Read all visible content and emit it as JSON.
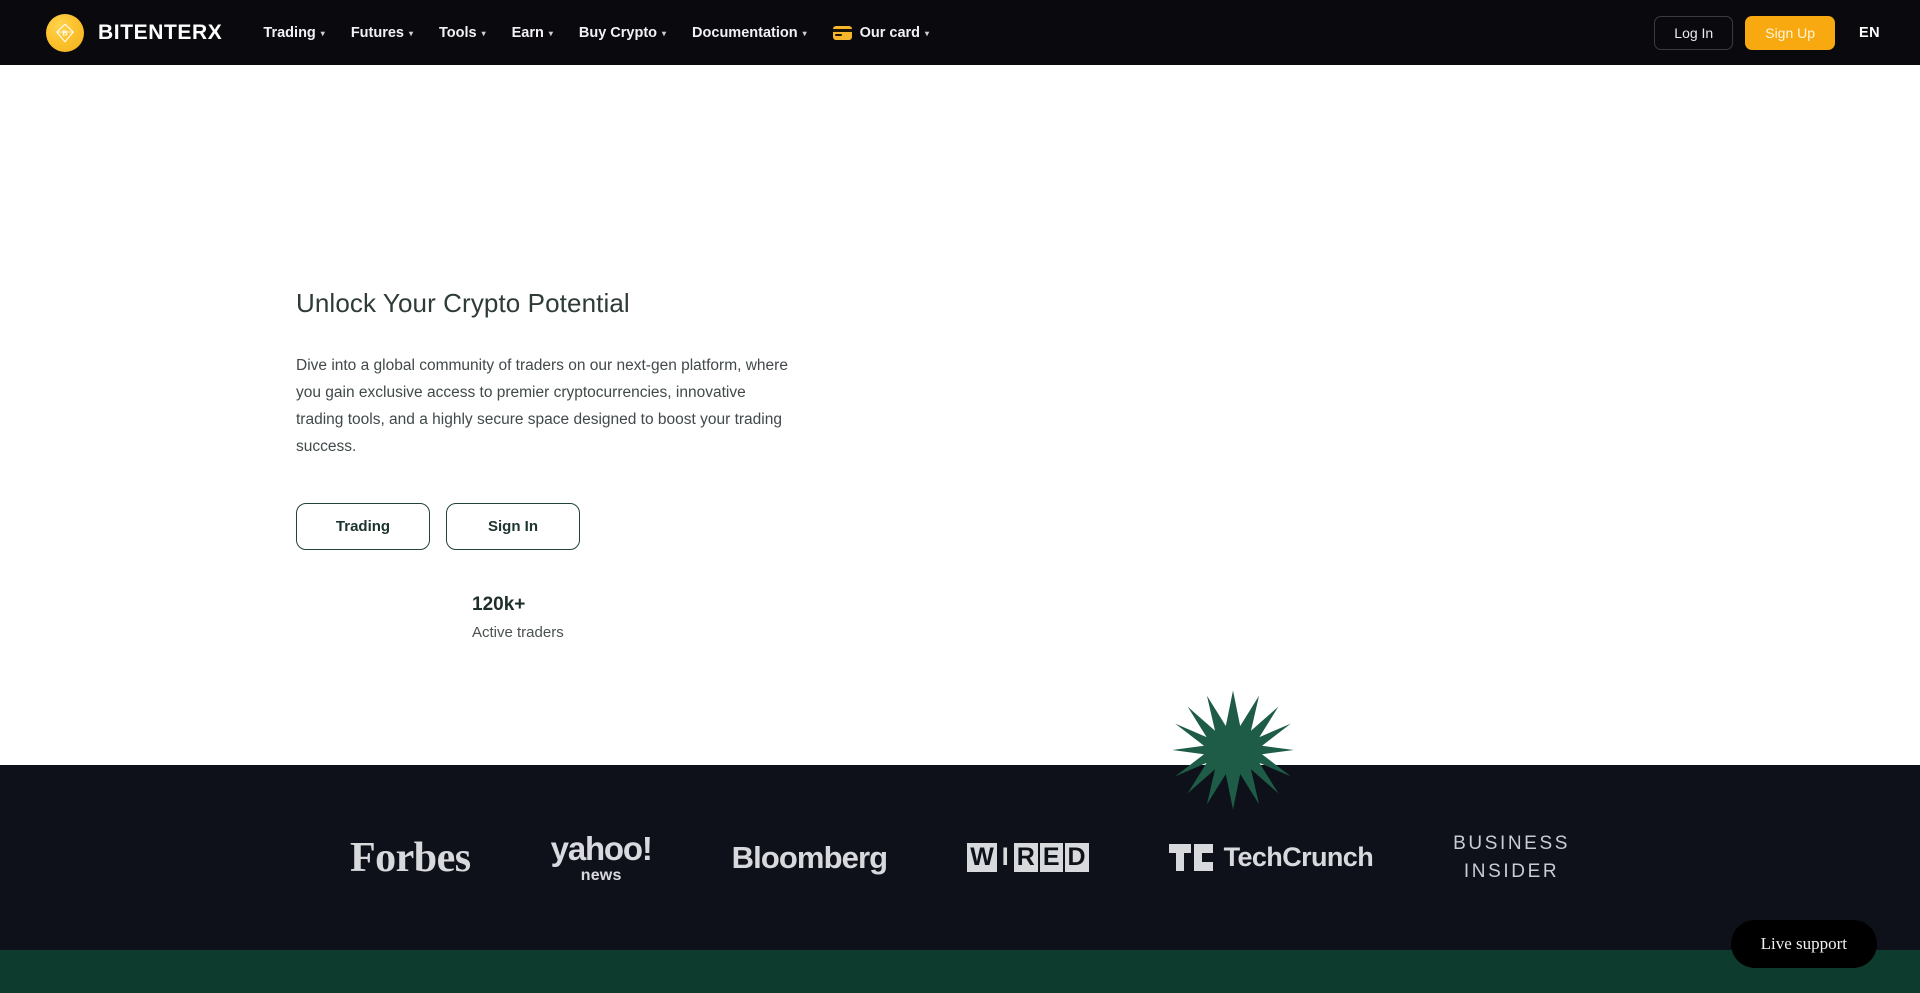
{
  "header": {
    "brand": {
      "name": "BITENTERX",
      "mark_icon": "bitcoin-diamond-icon",
      "mark_color": "#fcc22e"
    },
    "nav": [
      {
        "label": "Trading",
        "has_dropdown": true,
        "icon": null
      },
      {
        "label": "Futures",
        "has_dropdown": true,
        "icon": null
      },
      {
        "label": "Tools",
        "has_dropdown": true,
        "icon": null
      },
      {
        "label": "Earn",
        "has_dropdown": true,
        "icon": null
      },
      {
        "label": "Buy Crypto",
        "has_dropdown": true,
        "icon": null
      },
      {
        "label": "Documentation",
        "has_dropdown": true,
        "icon": null
      },
      {
        "label": "Our card",
        "has_dropdown": true,
        "icon": "credit-card-icon"
      }
    ],
    "login_label": "Log In",
    "signup_label": "Sign Up",
    "language": "EN",
    "signup_color": "#f7a90f",
    "background": "#0a0a0e"
  },
  "hero": {
    "title": "Unlock Your Crypto Potential",
    "subtitle": "Dive into a global community of traders on our next-gen platform, where you gain exclusive access to premier cryptocurrencies, innovative trading tools, and a highly secure space designed to boost your trading success.",
    "primary_button": "Trading",
    "secondary_button": "Sign In",
    "stat_value": "120k+",
    "stat_label": "Active traders",
    "accent_color": "#1f5c47",
    "background": "#ffffff"
  },
  "starburst": {
    "icon": "star-burst-icon",
    "points": 12,
    "color": "#1f5c47"
  },
  "logos": {
    "background": "#0e1119",
    "items": [
      {
        "name": "Forbes",
        "text": "Forbes"
      },
      {
        "name": "Yahoo News",
        "text_top": "yahoo!",
        "text_bottom": "news"
      },
      {
        "name": "Bloomberg",
        "text": "Bloomberg"
      },
      {
        "name": "WIRED",
        "letters": [
          "W",
          "I",
          "R",
          "E",
          "D"
        ]
      },
      {
        "name": "TechCrunch",
        "text": "TechCrunch"
      },
      {
        "name": "Business Insider",
        "text_top": "BUSINESS",
        "text_bottom": "INSIDER"
      }
    ]
  },
  "footer_band": {
    "color": "#0d3b2e"
  },
  "live_support": {
    "label": "Live support"
  }
}
